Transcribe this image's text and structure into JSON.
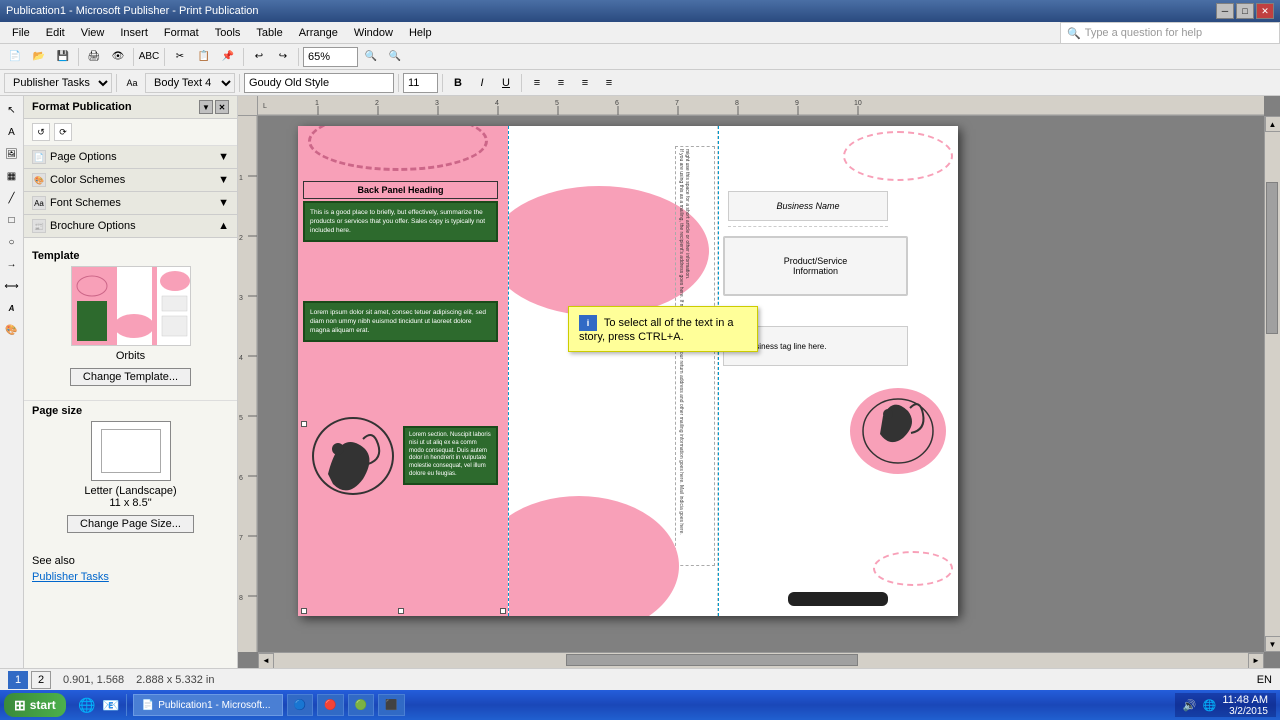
{
  "window": {
    "title": "Publication1 - Microsoft Publisher - Print Publication",
    "minimize": "─",
    "maximize": "□",
    "close": "✕"
  },
  "menu": {
    "items": [
      "File",
      "Edit",
      "View",
      "Insert",
      "Format",
      "Tools",
      "Table",
      "Arrange",
      "Window",
      "Help"
    ]
  },
  "question_box": {
    "placeholder": "Type a question for help"
  },
  "toolbar1": {
    "zoom": "65%"
  },
  "toolbar2": {
    "task_dropdown": "Publisher Tasks",
    "font_name": "Body Text 4",
    "font_face": "Goudy Old Style",
    "font_size": "11",
    "bold": "B",
    "italic": "I",
    "underline": "U"
  },
  "side_panel": {
    "title": "Format Publication",
    "sections": {
      "page_options": "Page Options",
      "color_schemes": "Color Schemes",
      "font_schemes": "Font Schemes",
      "brochure_options": "Brochure Options"
    },
    "template": {
      "label": "Template",
      "name": "Orbits",
      "change_btn": "Change Template..."
    },
    "page_size": {
      "label": "Page size",
      "size_name": "Letter (Landscape)",
      "dimensions": "11 x 8.5\"",
      "change_btn": "Change Page Size..."
    },
    "see_also": {
      "title": "See also",
      "link": "Publisher Tasks"
    }
  },
  "brochure": {
    "left_panel": {
      "heading": "Back Panel Heading",
      "body1": "This is a good place to briefly, but effectively, summarize the products or services that you offer. Sales copy is typically not included here.",
      "body2": "Lorem ipsum dolor sit amet, consec tetuer adipiscing elit, sed diam non ummy nibh euismod tincidunt ut laoreet dolore magna aliquam erat."
    },
    "right_panel": {
      "business_name": "Business Name",
      "product_service": "Product/Service\nInformation",
      "tagline": "Your business tag line here."
    }
  },
  "tooltip": {
    "text": "To select all of the text in a story, press CTRL+A."
  },
  "status_bar": {
    "language": "EN",
    "coordinates": "0.901, 1.568",
    "dimensions": "2.888 x 5.332 in",
    "time": "11:48 AM",
    "date": "3/2/2015",
    "page1": "1",
    "page2": "2"
  },
  "taskbar": {
    "start": "start",
    "apps": [
      "Publication1 - Microsoft Publisher"
    ]
  }
}
